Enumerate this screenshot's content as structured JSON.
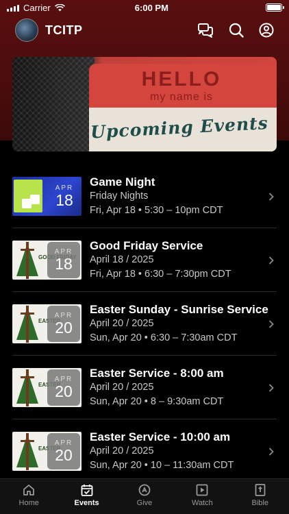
{
  "status_bar": {
    "carrier": "Carrier",
    "time": "6:00 PM"
  },
  "app_bar": {
    "title": "TCITP"
  },
  "hero": {
    "hello": "HELLO",
    "name_line": "my name is",
    "heading": "Upcoming Events"
  },
  "events": [
    {
      "title": "Game Night",
      "subtitle": "Friday Nights",
      "when": "Fri, Apr 18 • 5:30 – 10pm CDT",
      "month": "APR",
      "day": "18",
      "thumb_text": ""
    },
    {
      "title": "Good Friday Service",
      "subtitle": "April 18 / 2025",
      "when": "Fri, Apr 18 • 6:30 – 7:30pm CDT",
      "month": "APR",
      "day": "18",
      "thumb_text": "GOOD FRIDAY"
    },
    {
      "title": "Easter Sunday - Sunrise Service",
      "subtitle": "April 20 / 2025",
      "when": "Sun, Apr 20 • 6:30 – 7:30am CDT",
      "month": "APR",
      "day": "20",
      "thumb_text": "EASTER"
    },
    {
      "title": "Easter Service - 8:00 am",
      "subtitle": "April 20 / 2025",
      "when": "Sun, Apr 20 • 8 – 9:30am CDT",
      "month": "APR",
      "day": "20",
      "thumb_text": "EASTER"
    },
    {
      "title": "Easter Service - 10:00 am",
      "subtitle": "April 20 / 2025",
      "when": "Sun, Apr 20 • 10 – 11:30am CDT",
      "month": "APR",
      "day": "20",
      "thumb_text": "EASTER"
    }
  ],
  "tabs": [
    {
      "label": "Home",
      "icon": "home-icon",
      "active": false
    },
    {
      "label": "Events",
      "icon": "calendar-check-icon",
      "active": true
    },
    {
      "label": "Give",
      "icon": "give-icon",
      "active": false
    },
    {
      "label": "Watch",
      "icon": "play-icon",
      "active": false
    },
    {
      "label": "Bible",
      "icon": "bible-icon",
      "active": false
    }
  ],
  "colors": {
    "header_bg": "#4a0c0c",
    "background": "#000000",
    "tab_bar": "#121212",
    "muted_text": "#c8c8c8"
  }
}
